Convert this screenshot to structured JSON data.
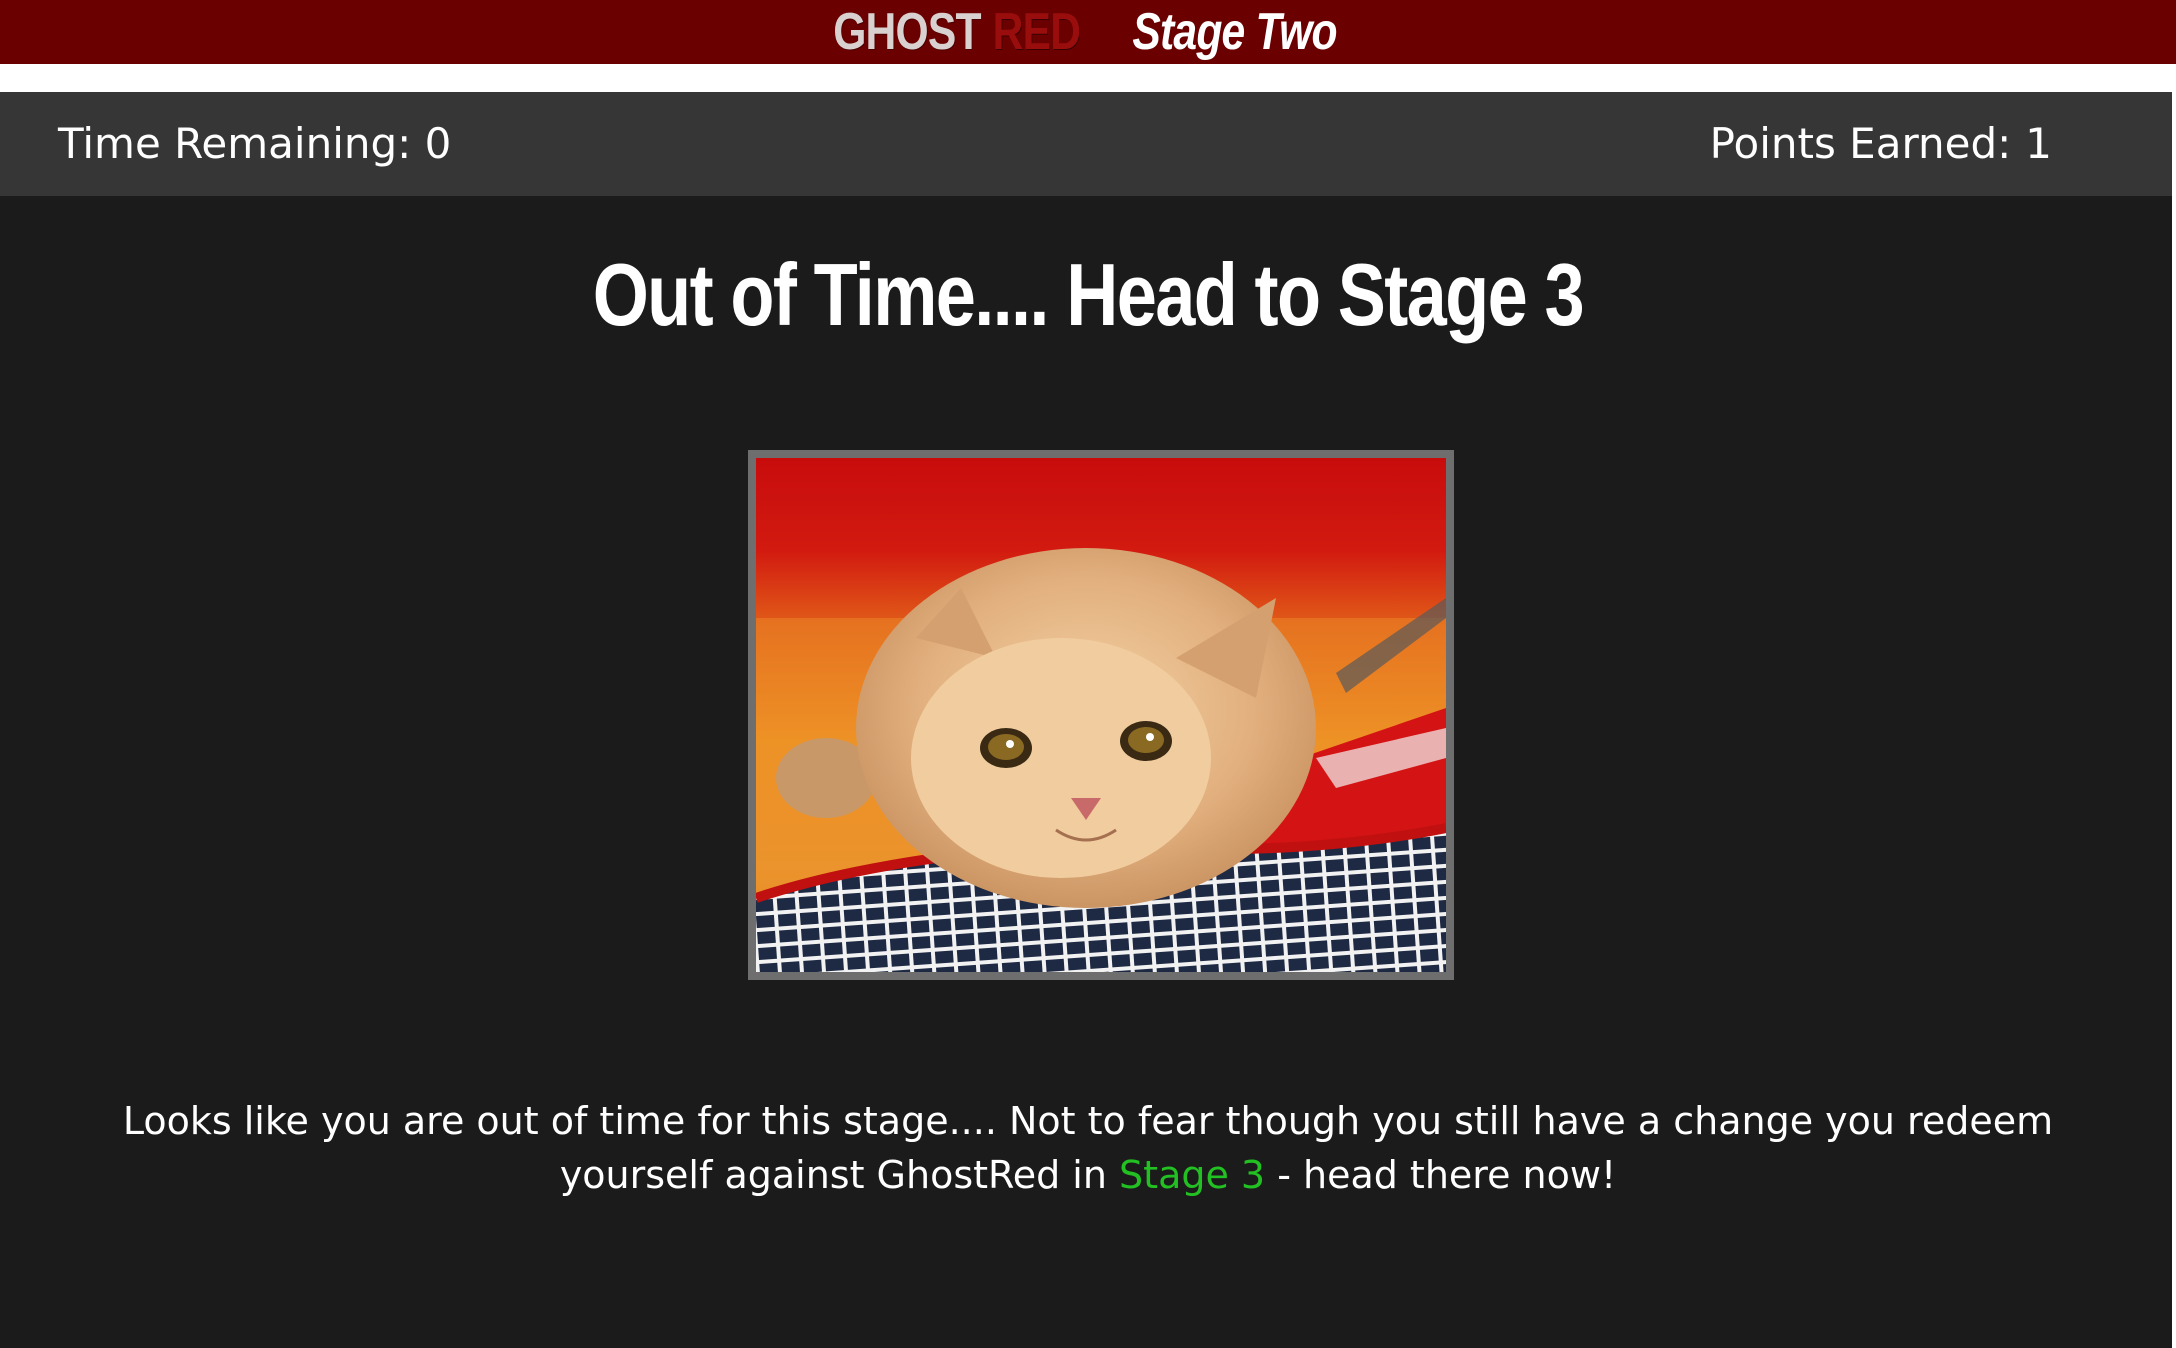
{
  "header": {
    "logo_ghost": "GHOST",
    "logo_red": "RED",
    "stage_label": "Stage Two"
  },
  "status": {
    "time_label": "Time Remaining: ",
    "time_value": "0",
    "points_label": "Points Earned:",
    "points_value": "1"
  },
  "main": {
    "headline": "Out of Time.... Head to Stage 3",
    "image_icon": "sad-kitten-image",
    "message_before": "Looks like you are out of time for this stage.... Not to fear though you still have a change you redeem yourself against GhostRed in ",
    "message_link": "Stage 3",
    "message_after": " - head there now!"
  },
  "colors": {
    "banner": "#6b0000",
    "statusbar": "#363636",
    "background": "#1b1b1b",
    "link": "#22c022"
  }
}
